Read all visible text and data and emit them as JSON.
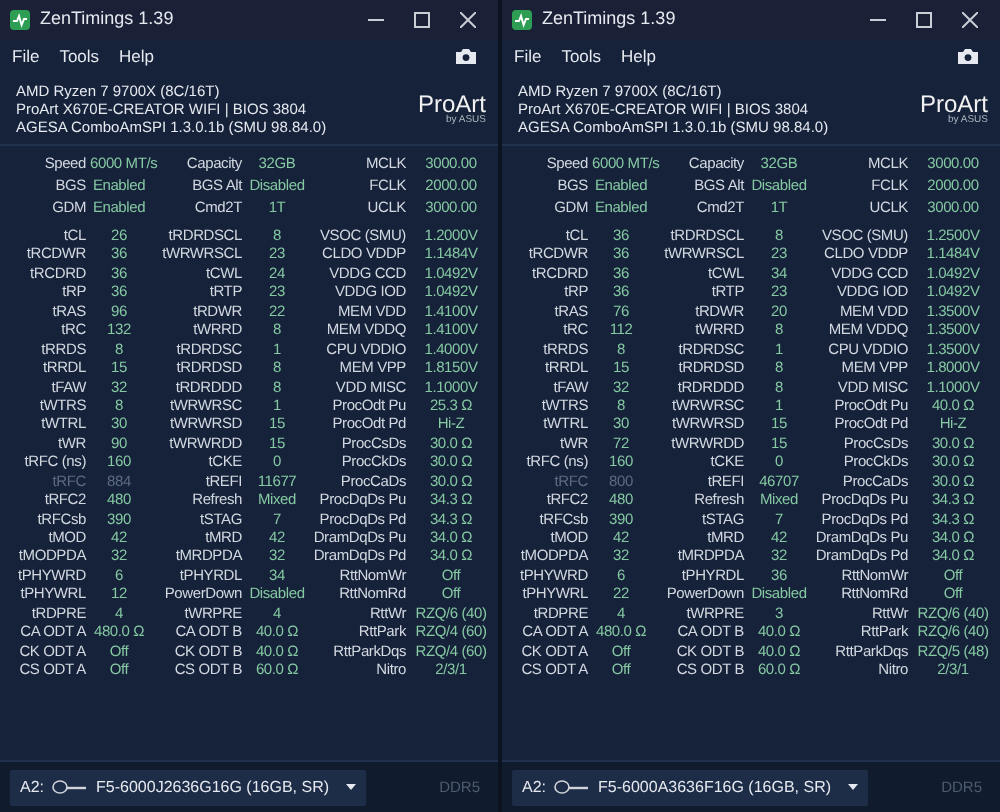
{
  "windows": [
    {
      "title": "ZenTimings 1.39",
      "menu": [
        "File",
        "Tools",
        "Help"
      ],
      "info_lines": [
        "AMD Ryzen 7 9700X (8C/16T)",
        "ProArt X670E-CREATOR WIFI | BIOS 3804",
        "AGESA ComboAmSPI 1.3.0.1b (SMU 98.84.0)"
      ],
      "brand": {
        "name": "ProArt",
        "byline": "by ASUS"
      },
      "summary": [
        [
          {
            "label": "Speed",
            "value": "6000 MT/s"
          },
          {
            "label": "Capacity",
            "value": "32GB"
          },
          {
            "label": "MCLK",
            "value": "3000.00"
          }
        ],
        [
          {
            "label": "BGS",
            "value": "Enabled"
          },
          {
            "label": "BGS Alt",
            "value": "Disabled"
          },
          {
            "label": "FCLK",
            "value": "2000.00"
          }
        ],
        [
          {
            "label": "GDM",
            "value": "Enabled"
          },
          {
            "label": "Cmd2T",
            "value": "1T"
          },
          {
            "label": "UCLK",
            "value": "3000.00"
          }
        ]
      ],
      "timings": [
        [
          {
            "label": "tCL",
            "value": "26",
            "dimmed": false
          },
          {
            "label": "tRDRDSCL",
            "value": "8",
            "dimmed": false
          },
          {
            "label": "VSOC (SMU)",
            "value": "1.2000V",
            "dimmed": false
          }
        ],
        [
          {
            "label": "tRCDWR",
            "value": "36",
            "dimmed": false
          },
          {
            "label": "tWRWRSCL",
            "value": "23",
            "dimmed": false
          },
          {
            "label": "CLDO VDDP",
            "value": "1.1484V",
            "dimmed": false
          }
        ],
        [
          {
            "label": "tRCDRD",
            "value": "36",
            "dimmed": false
          },
          {
            "label": "tCWL",
            "value": "24",
            "dimmed": false
          },
          {
            "label": "VDDG CCD",
            "value": "1.0492V",
            "dimmed": false
          }
        ],
        [
          {
            "label": "tRP",
            "value": "36",
            "dimmed": false
          },
          {
            "label": "tRTP",
            "value": "23",
            "dimmed": false
          },
          {
            "label": "VDDG IOD",
            "value": "1.0492V",
            "dimmed": false
          }
        ],
        [
          {
            "label": "tRAS",
            "value": "96",
            "dimmed": false
          },
          {
            "label": "tRDWR",
            "value": "22",
            "dimmed": false
          },
          {
            "label": "MEM VDD",
            "value": "1.4100V",
            "dimmed": false
          }
        ],
        [
          {
            "label": "tRC",
            "value": "132",
            "dimmed": false
          },
          {
            "label": "tWRRD",
            "value": "8",
            "dimmed": false
          },
          {
            "label": "MEM VDDQ",
            "value": "1.4100V",
            "dimmed": false
          }
        ],
        [
          {
            "label": "tRRDS",
            "value": "8",
            "dimmed": false
          },
          {
            "label": "tRDRDSC",
            "value": "1",
            "dimmed": false
          },
          {
            "label": "CPU VDDIO",
            "value": "1.4000V",
            "dimmed": false
          }
        ],
        [
          {
            "label": "tRRDL",
            "value": "15",
            "dimmed": false
          },
          {
            "label": "tRDRDSD",
            "value": "8",
            "dimmed": false
          },
          {
            "label": "MEM VPP",
            "value": "1.8150V",
            "dimmed": false
          }
        ],
        [
          {
            "label": "tFAW",
            "value": "32",
            "dimmed": false
          },
          {
            "label": "tRDRDDD",
            "value": "8",
            "dimmed": false
          },
          {
            "label": "VDD MISC",
            "value": "1.1000V",
            "dimmed": false
          }
        ],
        [
          {
            "label": "tWTRS",
            "value": "8",
            "dimmed": false
          },
          {
            "label": "tWRWRSC",
            "value": "1",
            "dimmed": false
          },
          {
            "label": "ProcOdt Pu",
            "value": "25.3 Ω",
            "dimmed": false
          }
        ],
        [
          {
            "label": "tWTRL",
            "value": "30",
            "dimmed": false
          },
          {
            "label": "tWRWRSD",
            "value": "15",
            "dimmed": false
          },
          {
            "label": "ProcOdt Pd",
            "value": "Hi-Z",
            "dimmed": false
          }
        ],
        [
          {
            "label": "tWR",
            "value": "90",
            "dimmed": false
          },
          {
            "label": "tWRWRDD",
            "value": "15",
            "dimmed": false
          },
          {
            "label": "ProcCsDs",
            "value": "30.0 Ω",
            "dimmed": false
          }
        ],
        [
          {
            "label": "tRFC (ns)",
            "value": "160",
            "dimmed": false
          },
          {
            "label": "tCKE",
            "value": "0",
            "dimmed": false
          },
          {
            "label": "ProcCkDs",
            "value": "30.0 Ω",
            "dimmed": false
          }
        ],
        [
          {
            "label": "tRFC",
            "value": "884",
            "dimmed": true
          },
          {
            "label": "tREFI",
            "value": "11677",
            "dimmed": false
          },
          {
            "label": "ProcCaDs",
            "value": "30.0 Ω",
            "dimmed": false
          }
        ],
        [
          {
            "label": "tRFC2",
            "value": "480",
            "dimmed": false
          },
          {
            "label": "Refresh",
            "value": "Mixed",
            "dimmed": false
          },
          {
            "label": "ProcDqDs Pu",
            "value": "34.3 Ω",
            "dimmed": false
          }
        ],
        [
          {
            "label": "tRFCsb",
            "value": "390",
            "dimmed": false
          },
          {
            "label": "tSTAG",
            "value": "7",
            "dimmed": false
          },
          {
            "label": "ProcDqDs Pd",
            "value": "34.3 Ω",
            "dimmed": false
          }
        ],
        [
          {
            "label": "tMOD",
            "value": "42",
            "dimmed": false
          },
          {
            "label": "tMRD",
            "value": "42",
            "dimmed": false
          },
          {
            "label": "DramDqDs Pu",
            "value": "34.0 Ω",
            "dimmed": false
          }
        ],
        [
          {
            "label": "tMODPDA",
            "value": "32",
            "dimmed": false
          },
          {
            "label": "tMRDPDA",
            "value": "32",
            "dimmed": false
          },
          {
            "label": "DramDqDs Pd",
            "value": "34.0 Ω",
            "dimmed": false
          }
        ],
        [
          {
            "label": "tPHYWRD",
            "value": "6",
            "dimmed": false
          },
          {
            "label": "tPHYRDL",
            "value": "34",
            "dimmed": false
          },
          {
            "label": "RttNomWr",
            "value": "Off",
            "dimmed": false
          }
        ],
        [
          {
            "label": "tPHYWRL",
            "value": "12",
            "dimmed": false
          },
          {
            "label": "PowerDown",
            "value": "Disabled",
            "dimmed": false
          },
          {
            "label": "RttNomRd",
            "value": "Off",
            "dimmed": false
          }
        ],
        [
          {
            "label": "tRDPRE",
            "value": "4",
            "dimmed": false
          },
          {
            "label": "tWRPRE",
            "value": "4",
            "dimmed": false
          },
          {
            "label": "RttWr",
            "value": "RZQ/6 (40)",
            "dimmed": false
          }
        ],
        [
          {
            "label": "CA ODT A",
            "value": "480.0 Ω",
            "dimmed": false
          },
          {
            "label": "CA ODT B",
            "value": "40.0 Ω",
            "dimmed": false
          },
          {
            "label": "RttPark",
            "value": "RZQ/4 (60)",
            "dimmed": false
          }
        ],
        [
          {
            "label": "CK ODT A",
            "value": "Off",
            "dimmed": false
          },
          {
            "label": "CK ODT B",
            "value": "40.0 Ω",
            "dimmed": false
          },
          {
            "label": "RttParkDqs",
            "value": "RZQ/4 (60)",
            "dimmed": false
          }
        ],
        [
          {
            "label": "CS ODT A",
            "value": "Off",
            "dimmed": false
          },
          {
            "label": "CS ODT B",
            "value": "60.0 Ω",
            "dimmed": false
          },
          {
            "label": "Nitro",
            "value": "2/3/1",
            "dimmed": false
          }
        ]
      ],
      "module": {
        "slot": "A2:",
        "part": "F5-6000J2636G16G (16GB, SR)",
        "type": "DDR5"
      }
    },
    {
      "title": "ZenTimings 1.39",
      "menu": [
        "File",
        "Tools",
        "Help"
      ],
      "info_lines": [
        "AMD Ryzen 7 9700X (8C/16T)",
        "ProArt X670E-CREATOR WIFI | BIOS 3804",
        "AGESA ComboAmSPI 1.3.0.1b (SMU 98.84.0)"
      ],
      "brand": {
        "name": "ProArt",
        "byline": "by ASUS"
      },
      "summary": [
        [
          {
            "label": "Speed",
            "value": "6000 MT/s"
          },
          {
            "label": "Capacity",
            "value": "32GB"
          },
          {
            "label": "MCLK",
            "value": "3000.00"
          }
        ],
        [
          {
            "label": "BGS",
            "value": "Enabled"
          },
          {
            "label": "BGS Alt",
            "value": "Disabled"
          },
          {
            "label": "FCLK",
            "value": "2000.00"
          }
        ],
        [
          {
            "label": "GDM",
            "value": "Enabled"
          },
          {
            "label": "Cmd2T",
            "value": "1T"
          },
          {
            "label": "UCLK",
            "value": "3000.00"
          }
        ]
      ],
      "timings": [
        [
          {
            "label": "tCL",
            "value": "36",
            "dimmed": false
          },
          {
            "label": "tRDRDSCL",
            "value": "8",
            "dimmed": false
          },
          {
            "label": "VSOC (SMU)",
            "value": "1.2500V",
            "dimmed": false
          }
        ],
        [
          {
            "label": "tRCDWR",
            "value": "36",
            "dimmed": false
          },
          {
            "label": "tWRWRSCL",
            "value": "23",
            "dimmed": false
          },
          {
            "label": "CLDO VDDP",
            "value": "1.1484V",
            "dimmed": false
          }
        ],
        [
          {
            "label": "tRCDRD",
            "value": "36",
            "dimmed": false
          },
          {
            "label": "tCWL",
            "value": "34",
            "dimmed": false
          },
          {
            "label": "VDDG CCD",
            "value": "1.0492V",
            "dimmed": false
          }
        ],
        [
          {
            "label": "tRP",
            "value": "36",
            "dimmed": false
          },
          {
            "label": "tRTP",
            "value": "23",
            "dimmed": false
          },
          {
            "label": "VDDG IOD",
            "value": "1.0492V",
            "dimmed": false
          }
        ],
        [
          {
            "label": "tRAS",
            "value": "76",
            "dimmed": false
          },
          {
            "label": "tRDWR",
            "value": "20",
            "dimmed": false
          },
          {
            "label": "MEM VDD",
            "value": "1.3500V",
            "dimmed": false
          }
        ],
        [
          {
            "label": "tRC",
            "value": "112",
            "dimmed": false
          },
          {
            "label": "tWRRD",
            "value": "8",
            "dimmed": false
          },
          {
            "label": "MEM VDDQ",
            "value": "1.3500V",
            "dimmed": false
          }
        ],
        [
          {
            "label": "tRRDS",
            "value": "8",
            "dimmed": false
          },
          {
            "label": "tRDRDSC",
            "value": "1",
            "dimmed": false
          },
          {
            "label": "CPU VDDIO",
            "value": "1.3500V",
            "dimmed": false
          }
        ],
        [
          {
            "label": "tRRDL",
            "value": "15",
            "dimmed": false
          },
          {
            "label": "tRDRDSD",
            "value": "8",
            "dimmed": false
          },
          {
            "label": "MEM VPP",
            "value": "1.8000V",
            "dimmed": false
          }
        ],
        [
          {
            "label": "tFAW",
            "value": "32",
            "dimmed": false
          },
          {
            "label": "tRDRDDD",
            "value": "8",
            "dimmed": false
          },
          {
            "label": "VDD MISC",
            "value": "1.1000V",
            "dimmed": false
          }
        ],
        [
          {
            "label": "tWTRS",
            "value": "8",
            "dimmed": false
          },
          {
            "label": "tWRWRSC",
            "value": "1",
            "dimmed": false
          },
          {
            "label": "ProcOdt Pu",
            "value": "40.0 Ω",
            "dimmed": false
          }
        ],
        [
          {
            "label": "tWTRL",
            "value": "30",
            "dimmed": false
          },
          {
            "label": "tWRWRSD",
            "value": "15",
            "dimmed": false
          },
          {
            "label": "ProcOdt Pd",
            "value": "Hi-Z",
            "dimmed": false
          }
        ],
        [
          {
            "label": "tWR",
            "value": "72",
            "dimmed": false
          },
          {
            "label": "tWRWRDD",
            "value": "15",
            "dimmed": false
          },
          {
            "label": "ProcCsDs",
            "value": "30.0 Ω",
            "dimmed": false
          }
        ],
        [
          {
            "label": "tRFC (ns)",
            "value": "160",
            "dimmed": false
          },
          {
            "label": "tCKE",
            "value": "0",
            "dimmed": false
          },
          {
            "label": "ProcCkDs",
            "value": "30.0 Ω",
            "dimmed": false
          }
        ],
        [
          {
            "label": "tRFC",
            "value": "800",
            "dimmed": true
          },
          {
            "label": "tREFI",
            "value": "46707",
            "dimmed": false
          },
          {
            "label": "ProcCaDs",
            "value": "30.0 Ω",
            "dimmed": false
          }
        ],
        [
          {
            "label": "tRFC2",
            "value": "480",
            "dimmed": false
          },
          {
            "label": "Refresh",
            "value": "Mixed",
            "dimmed": false
          },
          {
            "label": "ProcDqDs Pu",
            "value": "34.3 Ω",
            "dimmed": false
          }
        ],
        [
          {
            "label": "tRFCsb",
            "value": "390",
            "dimmed": false
          },
          {
            "label": "tSTAG",
            "value": "7",
            "dimmed": false
          },
          {
            "label": "ProcDqDs Pd",
            "value": "34.3 Ω",
            "dimmed": false
          }
        ],
        [
          {
            "label": "tMOD",
            "value": "42",
            "dimmed": false
          },
          {
            "label": "tMRD",
            "value": "42",
            "dimmed": false
          },
          {
            "label": "DramDqDs Pu",
            "value": "34.0 Ω",
            "dimmed": false
          }
        ],
        [
          {
            "label": "tMODPDA",
            "value": "32",
            "dimmed": false
          },
          {
            "label": "tMRDPDA",
            "value": "32",
            "dimmed": false
          },
          {
            "label": "DramDqDs Pd",
            "value": "34.0 Ω",
            "dimmed": false
          }
        ],
        [
          {
            "label": "tPHYWRD",
            "value": "6",
            "dimmed": false
          },
          {
            "label": "tPHYRDL",
            "value": "36",
            "dimmed": false
          },
          {
            "label": "RttNomWr",
            "value": "Off",
            "dimmed": false
          }
        ],
        [
          {
            "label": "tPHYWRL",
            "value": "22",
            "dimmed": false
          },
          {
            "label": "PowerDown",
            "value": "Disabled",
            "dimmed": false
          },
          {
            "label": "RttNomRd",
            "value": "Off",
            "dimmed": false
          }
        ],
        [
          {
            "label": "tRDPRE",
            "value": "4",
            "dimmed": false
          },
          {
            "label": "tWRPRE",
            "value": "3",
            "dimmed": false
          },
          {
            "label": "RttWr",
            "value": "RZQ/6 (40)",
            "dimmed": false
          }
        ],
        [
          {
            "label": "CA ODT A",
            "value": "480.0 Ω",
            "dimmed": false
          },
          {
            "label": "CA ODT B",
            "value": "40.0 Ω",
            "dimmed": false
          },
          {
            "label": "RttPark",
            "value": "RZQ/6 (40)",
            "dimmed": false
          }
        ],
        [
          {
            "label": "CK ODT A",
            "value": "Off",
            "dimmed": false
          },
          {
            "label": "CK ODT B",
            "value": "40.0 Ω",
            "dimmed": false
          },
          {
            "label": "RttParkDqs",
            "value": "RZQ/5 (48)",
            "dimmed": false
          }
        ],
        [
          {
            "label": "CS ODT A",
            "value": "Off",
            "dimmed": false
          },
          {
            "label": "CS ODT B",
            "value": "60.0 Ω",
            "dimmed": false
          },
          {
            "label": "Nitro",
            "value": "2/3/1",
            "dimmed": false
          }
        ]
      ],
      "module": {
        "slot": "A2:",
        "part": "F5-6000A3636F16G (16GB, SR)",
        "type": "DDR5"
      }
    }
  ]
}
